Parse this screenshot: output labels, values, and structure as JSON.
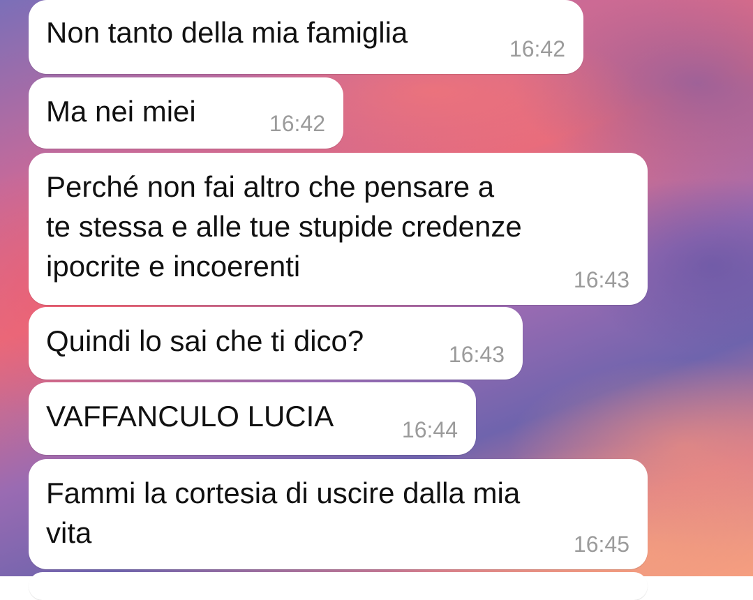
{
  "messages": [
    {
      "text": "Non tanto della mia famiglia",
      "time": "16:42"
    },
    {
      "text": "Ma nei miei",
      "time": "16:42"
    },
    {
      "text": "Perché non fai altro che pensare a\nte stessa e alle tue stupide credenze\nipocrite e incoerenti",
      "time": "16:43"
    },
    {
      "text": "Quindi lo sai che ti dico?",
      "time": "16:43"
    },
    {
      "text": "VAFFANCULO LUCIA",
      "time": "16:44"
    },
    {
      "text": "Fammi la cortesia di uscire dalla mia\nvita",
      "time": "16:45"
    }
  ]
}
